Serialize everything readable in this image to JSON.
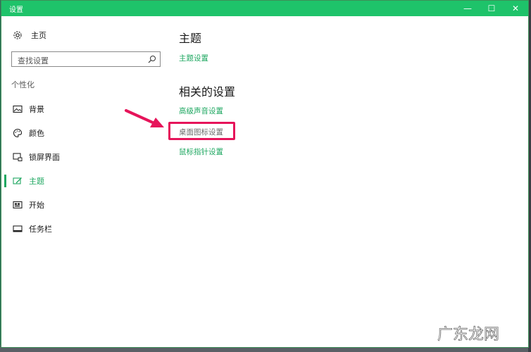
{
  "window": {
    "title": "设置",
    "controls": {
      "minimize": "—",
      "maximize": "☐",
      "close": "✕"
    }
  },
  "sidebar": {
    "home_label": "主页",
    "search_placeholder": "查找设置",
    "section_label": "个性化",
    "items": [
      {
        "label": "背景",
        "icon": "image-icon",
        "active": false
      },
      {
        "label": "颜色",
        "icon": "palette-icon",
        "active": false
      },
      {
        "label": "锁屏界面",
        "icon": "lock-screen-icon",
        "active": false
      },
      {
        "label": "主题",
        "icon": "theme-icon",
        "active": true
      },
      {
        "label": "开始",
        "icon": "start-icon",
        "active": false
      },
      {
        "label": "任务栏",
        "icon": "taskbar-icon",
        "active": false
      }
    ]
  },
  "main": {
    "theme_heading": "主题",
    "theme_settings_link": "主题设置",
    "related_heading": "相关的设置",
    "links": [
      {
        "label": "高级声音设置"
      },
      {
        "label": "桌面图标设置",
        "highlighted": true
      },
      {
        "label": "鼠标指针设置"
      }
    ]
  },
  "colors": {
    "accent": "#1ea760",
    "titlebar": "#1ec36a",
    "highlight_border": "#e6145a",
    "arrow": "#e6145a"
  }
}
